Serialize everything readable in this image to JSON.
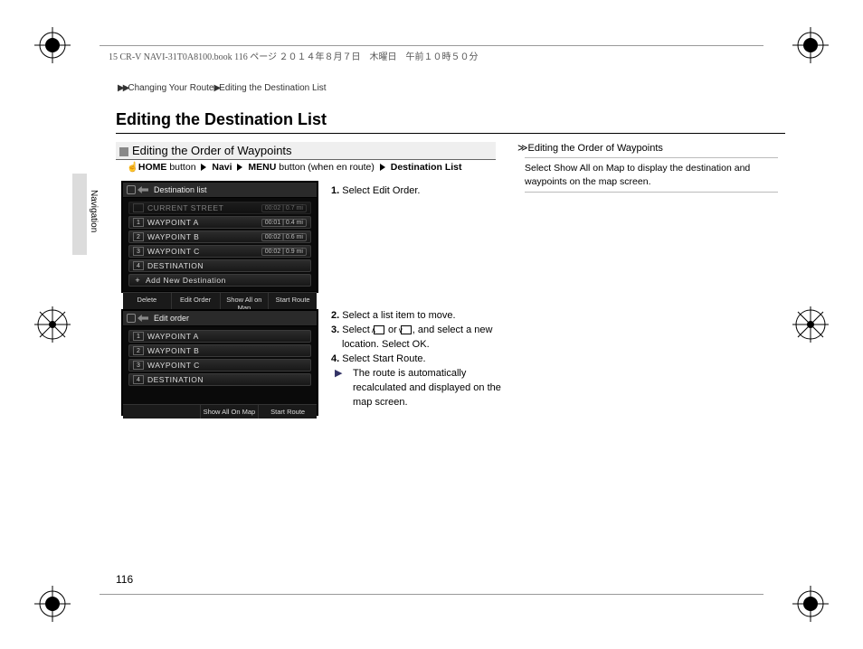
{
  "header_text": "15 CR-V NAVI-31T0A8100.book  116 ページ  ２０１４年８月７日　木曜日　午前１０時５０分",
  "page_number": "116",
  "breadcrumb": {
    "a": "Changing Your Route",
    "b": "Editing the Destination List"
  },
  "page_title": "Editing the Destination List",
  "subsection_title": "Editing the Order of Waypoints",
  "nav": {
    "home": "HOME",
    "button1": " button ",
    "navi": "Navi",
    "menu": "MENU",
    "button2": " button (when en route) ",
    "dest": "Destination List"
  },
  "side_label": "Navigation",
  "screen1": {
    "title": "Destination list",
    "rows": [
      {
        "num": "",
        "label": "CURRENT STREET",
        "dist": "00:02 | 0.7 mi",
        "dim": true
      },
      {
        "num": "1",
        "label": "WAYPOINT A",
        "dist": "00:01 | 0.4 mi"
      },
      {
        "num": "2",
        "label": "WAYPOINT B",
        "dist": "00:02 | 0.6 mi"
      },
      {
        "num": "3",
        "label": "WAYPOINT C",
        "dist": "00:02 | 0.9 mi"
      },
      {
        "num": "4",
        "label": "DESTINATION",
        "dist": ""
      },
      {
        "plus": "+",
        "label": "Add New Destination",
        "dist": ""
      }
    ],
    "buttons": [
      "Delete",
      "Edit Order",
      "Show All on Map",
      "Start Route"
    ]
  },
  "screen2": {
    "title": "Edit order",
    "rows": [
      {
        "num": "1",
        "label": "WAYPOINT A"
      },
      {
        "num": "2",
        "label": "WAYPOINT B"
      },
      {
        "num": "3",
        "label": "WAYPOINT C"
      },
      {
        "num": "4",
        "label": "DESTINATION"
      }
    ],
    "buttons": [
      "Show All On Map",
      "Start Route"
    ]
  },
  "steps": {
    "s1a": "1.",
    "s1b": "Select ",
    "s1c": "Edit Order",
    "s1d": ".",
    "s2a": "2.",
    "s2b": "Select a list item to move.",
    "s3a": "3.",
    "s3b": "Select ",
    "s3up": "∧",
    "s3or": " or ",
    "s3dn": "∨",
    "s3c": ", and select a new location. Select ",
    "s3ok": "OK",
    "s3d": ".",
    "s4a": "4.",
    "s4b": "Select ",
    "s4c": "Start Route",
    "s4d": ".",
    "s4sub": "The route is automatically recalculated and displayed on the map screen."
  },
  "note": {
    "head": "Editing the Order of Waypoints",
    "body_a": "Select ",
    "body_b": "Show All on Map",
    "body_c": " to display the destination and waypoints on the map screen."
  }
}
